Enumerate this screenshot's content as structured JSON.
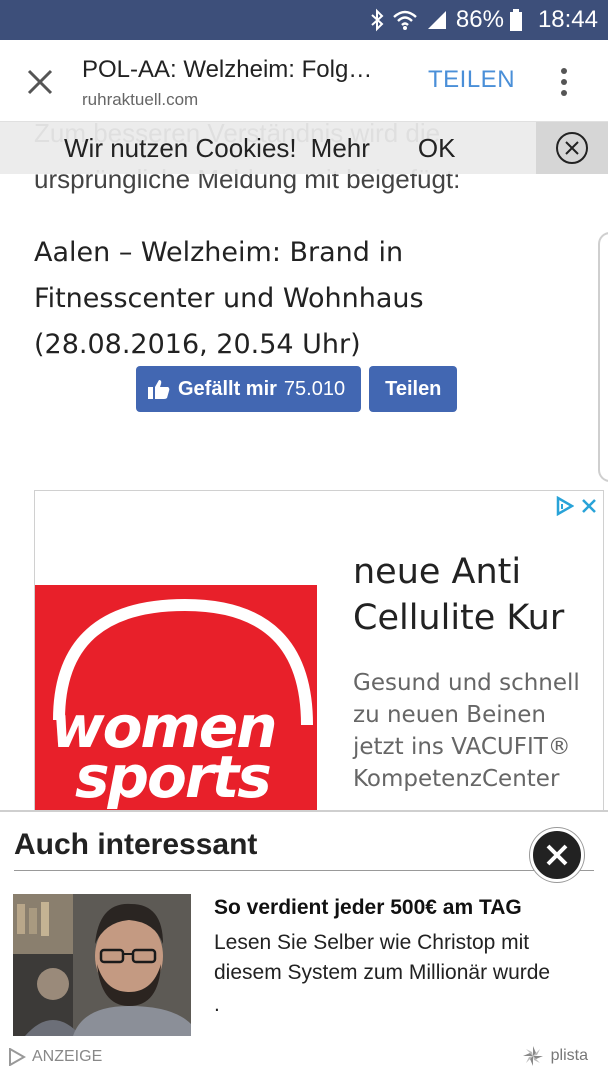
{
  "status_bar": {
    "battery_percent": "86%",
    "time": "18:44",
    "icons": [
      "bluetooth-icon",
      "wifi-icon",
      "cell-signal-icon",
      "battery-icon"
    ]
  },
  "tab_header": {
    "title": "POL-AA: Welzheim: Folg…",
    "domain": "ruhraktuell.com",
    "share_label": "TEILEN"
  },
  "article": {
    "behind_text_line1": "Zum besseren Verständnis wird die",
    "behind_text_line2": "ursprüngliche Meldung mit beigefügt:",
    "headline": "Aalen – Welzheim: Brand in Fitnesscenter und Wohnhaus (28.08.2016, 20.54 Uhr)"
  },
  "cookie_bar": {
    "text": "Wir nutzen Cookies!",
    "more_label": "Mehr",
    "ok_label": "OK"
  },
  "facebook": {
    "like_label": "Gefällt mir",
    "like_count": "75.010",
    "share_label": "Teilen"
  },
  "ad": {
    "logo_line1": "women",
    "logo_line2": "sports",
    "headline": "neue Anti Cellulite Kur",
    "body": "Gesund und schnell zu neuen Beinen jetzt ins VACUFIT® KompetenzCenter"
  },
  "recommendation_widget": {
    "title": "Auch interessant",
    "item_headline": "So verdient jeder 500€ am TAG",
    "item_text": "Lesen Sie Selber wie Christop mit diesem System zum Millionär wurde",
    "item_trailing": ".",
    "ad_label": "ANZEIGE",
    "brand": "plista"
  },
  "colors": {
    "status_bar": "#3d4f7a",
    "accent_link": "#4a8fd8",
    "facebook_blue": "#4267b2",
    "ad_red": "#e8202a"
  }
}
